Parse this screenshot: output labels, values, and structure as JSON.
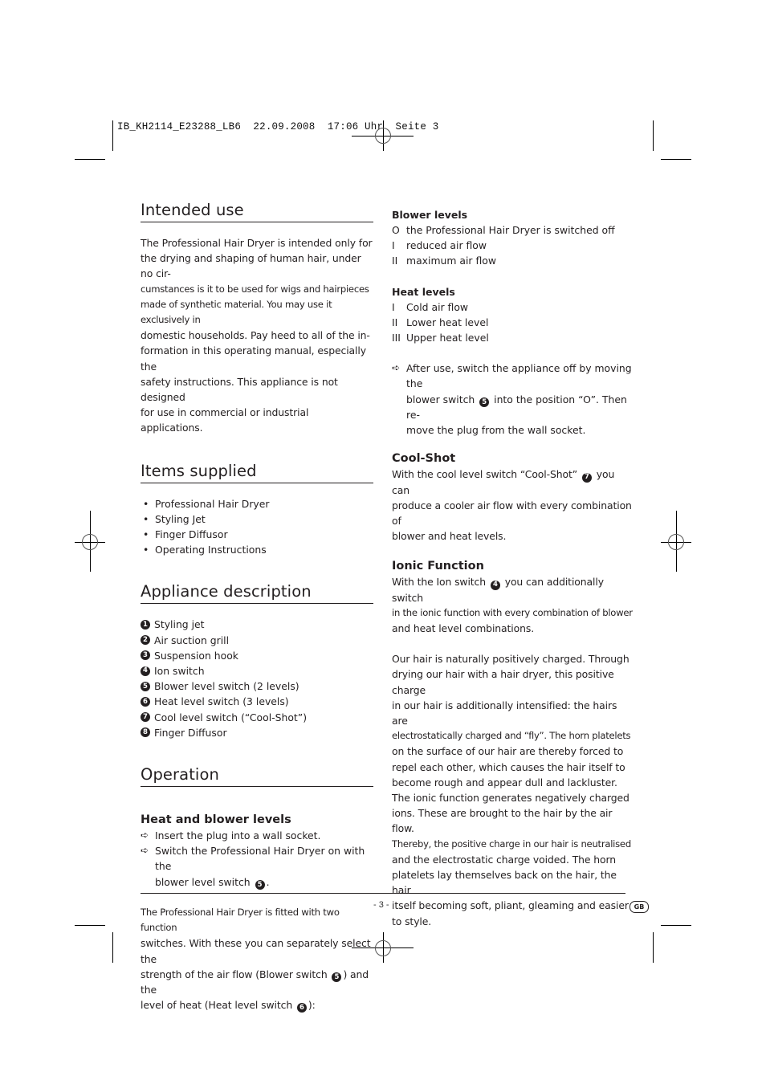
{
  "slug": {
    "text": "IB_KH2114_E23288_LB6  22.09.2008  17:06 Uhr  Seite 3"
  },
  "left": {
    "intended_use": {
      "title": "Intended use",
      "lines": [
        "The Professional Hair Dryer is intended only for",
        "the drying and shaping of human hair, under no cir-",
        "cumstances is it to be used for wigs and hairpieces",
        "made of synthetic material. You may use it exclusively in",
        "domestic households. Pay heed to all of the in-",
        "formation in this operating manual, especially the",
        "safety instructions. This appliance is not designed",
        "for use in commercial or industrial applications."
      ]
    },
    "items_supplied": {
      "title": "Items supplied",
      "bullet": "•",
      "items": [
        "Professional Hair Dryer",
        "Styling Jet",
        "Finger Diffusor",
        "Operating Instructions"
      ]
    },
    "appliance_description": {
      "title": "Appliance description",
      "items": [
        {
          "num": "1",
          "label": "Styling jet"
        },
        {
          "num": "2",
          "label": "Air suction grill"
        },
        {
          "num": "3",
          "label": "Suspension hook"
        },
        {
          "num": "4",
          "label": "Ion switch"
        },
        {
          "num": "5",
          "label": "Blower level switch (2 levels)"
        },
        {
          "num": "6",
          "label": "Heat level switch (3 levels)"
        },
        {
          "num": "7",
          "label": "Cool level switch (“Cool-Shot”)"
        },
        {
          "num": "8",
          "label": "Finger Diffusor"
        }
      ]
    },
    "operation": {
      "title": "Operation",
      "subtitle": "Heat and blower levels",
      "arrow": "➪",
      "step1": "Insert the plug into a wall socket.",
      "step2_a": "Switch the Professional Hair Dryer on with the",
      "step2_b": "blower level switch",
      "step2_num": "5",
      "step2_end": ".",
      "para_l1": "The Professional Hair Dryer is fitted with two function",
      "para_l2": "switches. With these you can separately select the",
      "para_l3a": "strength of the air flow (Blower switch",
      "para_l3_num": "5",
      "para_l3b": ") and the",
      "para_l4a": "level of heat (Heat level switch",
      "para_l4_num": "6",
      "para_l4b": "):"
    }
  },
  "right": {
    "blower_levels": {
      "title": "Blower levels",
      "items": [
        {
          "symbol": "O",
          "label": "the Professional Hair Dryer is switched off"
        },
        {
          "symbol": "I",
          "label": "reduced air flow"
        },
        {
          "symbol": "II",
          "label": "maximum air flow"
        }
      ]
    },
    "heat_levels": {
      "title": "Heat levels",
      "items": [
        {
          "symbol": "I",
          "label": "Cold air flow"
        },
        {
          "symbol": "II",
          "label": "Lower heat level"
        },
        {
          "symbol": "III",
          "label": "Upper heat level"
        }
      ]
    },
    "after_use": {
      "arrow": "➪",
      "l1": "After use, switch the appliance off by moving the",
      "l2a": "blower switch",
      "l2_num": "5",
      "l2b": "into the position “O”. Then re-",
      "l3": "move the plug from the wall socket."
    },
    "cool_shot": {
      "title": "Cool-Shot",
      "l1a": "With the cool level switch “Cool-Shot”",
      "l1_num": "7",
      "l1b": "you can",
      "l2": "produce a cooler air flow with every combination of",
      "l3": "blower and heat levels."
    },
    "ionic": {
      "title": "Ionic Function",
      "l1a": "With the Ion switch",
      "l1_num": "4",
      "l1b": "you can additionally switch",
      "l2": "in the ionic function with every combination of blower",
      "l3": "and heat level combinations.",
      "para": [
        "Our hair is naturally positively charged. Through",
        "drying our hair with a hair dryer, this positive charge",
        "in our hair is additionally intensified: the hairs are",
        "electrostatically charged and “fly”. The horn platelets",
        "on the surface of our hair are thereby forced to",
        "repel each other, which causes the hair itself to",
        "become rough and appear dull and lackluster.",
        "The ionic function generates negatively charged",
        "ions. These are brought to the hair by the air flow.",
        "Thereby, the positive charge in our hair is neutralised",
        "and the electrostatic charge voided. The horn",
        "platelets lay themselves back on the hair, the hair",
        "itself becoming soft, pliant, gleaming and easier",
        "to style."
      ]
    }
  },
  "footer": {
    "page": "- 3 -",
    "lang_badge": "GB"
  }
}
